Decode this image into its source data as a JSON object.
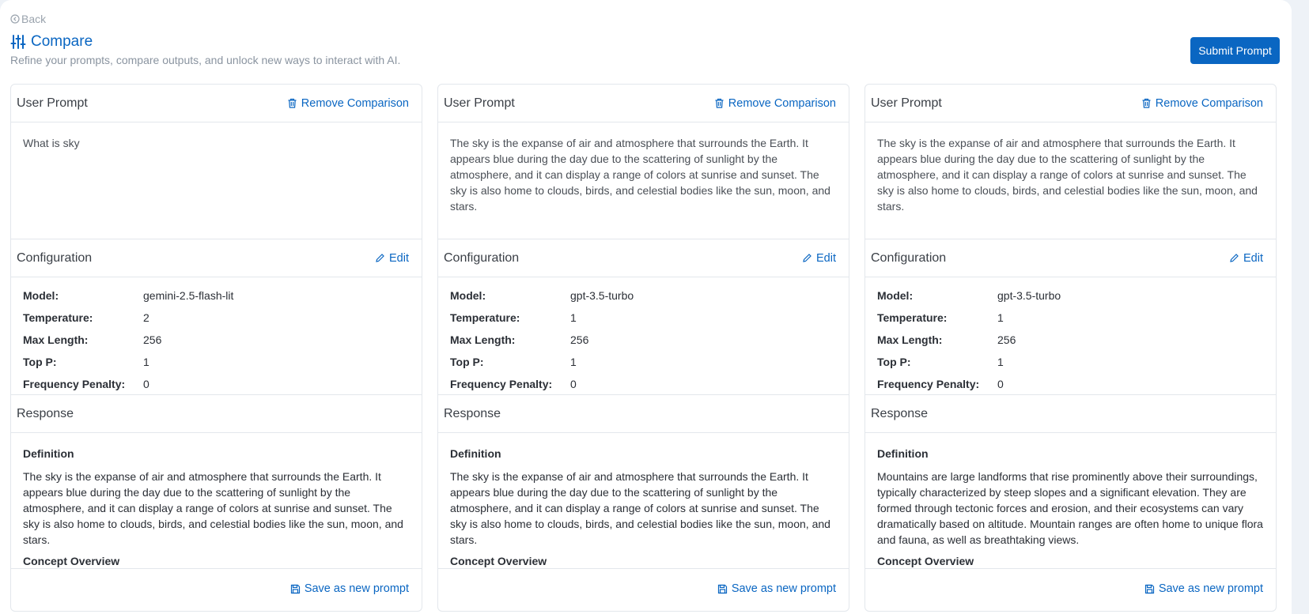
{
  "header": {
    "back_label": "Back",
    "title": "Compare",
    "subtitle": "Refine your prompts, compare outputs, and unlock new ways to interact with AI.",
    "submit_label": "Submit Prompt"
  },
  "columns": [
    {
      "user_prompt_title": "User Prompt",
      "remove_label": "Remove Comparison",
      "prompt_text": "What is sky",
      "config_title": "Configuration",
      "edit_label": "Edit",
      "config": {
        "model_label": "Model:",
        "model": "gemini-2.5-flash-lit",
        "temperature_label": "Temperature:",
        "temperature": "2",
        "max_length_label": "Max Length:",
        "max_length": "256",
        "top_p_label": "Top P:",
        "top_p": "1",
        "freq_label": "Frequency Penalty:",
        "freq": "0"
      },
      "response_title": "Response",
      "response_heading": "Definition",
      "response_text": "The sky is the expanse of air and atmosphere that surrounds the Earth. It appears blue during the day due to the scattering of sunlight by the atmosphere, and it can display a range of colors at sunrise and sunset. The sky is also home to clouds, birds, and celestial bodies like the sun, moon, and stars.",
      "response_heading2": "Concept Overview",
      "save_label": "Save as new prompt"
    },
    {
      "user_prompt_title": "User Prompt",
      "remove_label": "Remove Comparison",
      "prompt_text": "The sky is the expanse of air and atmosphere that surrounds the Earth. It appears blue during the day due to the scattering of sunlight by the atmosphere, and it can display a range of colors at sunrise and sunset. The sky is also home to clouds, birds, and celestial bodies like the sun, moon, and stars.",
      "config_title": "Configuration",
      "edit_label": "Edit",
      "config": {
        "model_label": "Model:",
        "model": "gpt-3.5-turbo",
        "temperature_label": "Temperature:",
        "temperature": "1",
        "max_length_label": "Max Length:",
        "max_length": "256",
        "top_p_label": "Top P:",
        "top_p": "1",
        "freq_label": "Frequency Penalty:",
        "freq": "0"
      },
      "response_title": "Response",
      "response_heading": "Definition",
      "response_text": "The sky is the expanse of air and atmosphere that surrounds the Earth. It appears blue during the day due to the scattering of sunlight by the atmosphere, and it can display a range of colors at sunrise and sunset. The sky is also home to clouds, birds, and celestial bodies like the sun, moon, and stars.",
      "response_heading2": "Concept Overview",
      "save_label": "Save as new prompt"
    },
    {
      "user_prompt_title": "User Prompt",
      "remove_label": "Remove Comparison",
      "prompt_text": "The sky is the expanse of air and atmosphere that surrounds the Earth. It appears blue during the day due to the scattering of sunlight by the atmosphere, and it can display a range of colors at sunrise and sunset. The sky is also home to clouds, birds, and celestial bodies like the sun, moon, and stars.",
      "config_title": "Configuration",
      "edit_label": "Edit",
      "config": {
        "model_label": "Model:",
        "model": "gpt-3.5-turbo",
        "temperature_label": "Temperature:",
        "temperature": "1",
        "max_length_label": "Max Length:",
        "max_length": "256",
        "top_p_label": "Top P:",
        "top_p": "1",
        "freq_label": "Frequency Penalty:",
        "freq": "0"
      },
      "response_title": "Response",
      "response_heading": "Definition",
      "response_text": "Mountains are large landforms that rise prominently above their surroundings, typically characterized by steep slopes and a significant elevation. They are formed through tectonic forces and erosion, and their ecosystems can vary dramatically based on altitude. Mountain ranges are often home to unique flora and fauna, as well as breathtaking views.",
      "response_heading2": "Concept Overview",
      "save_label": "Save as new prompt"
    }
  ],
  "colors": {
    "accent": "#0a66c2",
    "border": "#e3e7ec",
    "muted": "#8a94a0"
  },
  "icons": {
    "back": "circle-arrow-icon",
    "compare": "sliders-icon",
    "remove": "trash-icon",
    "edit": "pencil-icon",
    "save": "floppy-disk-icon"
  }
}
